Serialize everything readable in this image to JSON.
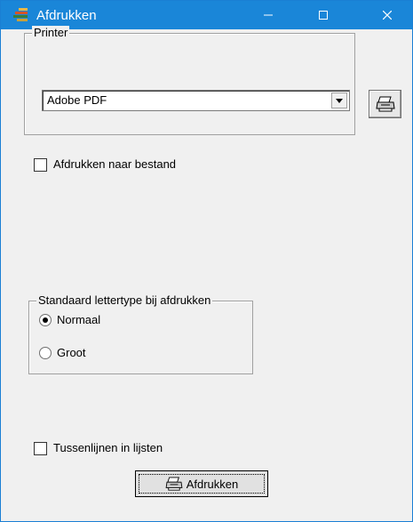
{
  "window": {
    "title": "Afdrukken"
  },
  "printer_group": {
    "legend": "Printer",
    "selected_printer": "Adobe PDF"
  },
  "print_to_file": {
    "label": "Afdrukken naar bestand",
    "checked": false
  },
  "font_group": {
    "legend": "Standaard lettertype bij afdrukken",
    "options": [
      {
        "label": "Normaal",
        "selected": true
      },
      {
        "label": "Groot",
        "selected": false
      }
    ]
  },
  "row_lines": {
    "label": "Tussenlijnen in lijsten",
    "checked": false
  },
  "print_button": {
    "label": "Afdrukken"
  },
  "colors": {
    "titlebar": "#1a86d8",
    "window_bg": "#f0f0f0"
  }
}
